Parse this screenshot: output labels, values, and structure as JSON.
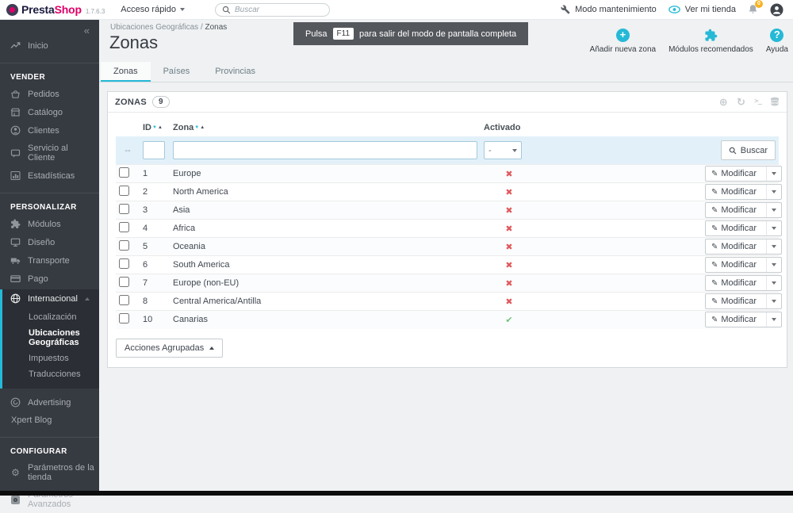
{
  "topbar": {
    "brand_presta": "Presta",
    "brand_shop": "Shop",
    "version": "1.7.6.3",
    "quick_access": "Acceso rápido",
    "search_placeholder": "Buscar",
    "maintenance_label": "Modo mantenimiento",
    "view_shop_label": "Ver mi tienda",
    "notification_badge": "0"
  },
  "sidebar": {
    "collapse": "«",
    "home": "Inicio",
    "vender_title": "VENDER",
    "pedidos": "Pedidos",
    "catalogo": "Catálogo",
    "clientes": "Clientes",
    "servicio": "Servicio al Cliente",
    "estadisticas": "Estadísticas",
    "personalizar_title": "PERSONALIZAR",
    "modulos": "Módulos",
    "diseno": "Diseño",
    "transporte": "Transporte",
    "pago": "Pago",
    "internacional": "Internacional",
    "localizacion": "Localización",
    "ubicaciones": "Ubicaciones Geográficas",
    "impuestos": "Impuestos",
    "traducciones": "Traducciones",
    "advertising": "Advertising",
    "xpert_blog": "Xpert Blog",
    "configurar_title": "CONFIGURAR",
    "parametros_tienda": "Parámetros de la tienda",
    "parametros_avanzados": "Parámetros Avanzados"
  },
  "header": {
    "breadcrumb_parent": "Ubicaciones Geográficas",
    "breadcrumb_sep": "/",
    "breadcrumb_current": "Zonas",
    "title": "Zonas",
    "toast": {
      "prefix": "Pulsa",
      "key": "F11",
      "suffix": "para salir del modo de pantalla completa"
    },
    "actions": {
      "add": "Añadir nueva zona",
      "modules": "Módulos recomendados",
      "help": "Ayuda"
    }
  },
  "tabs": {
    "zonas": "Zonas",
    "paises": "Países",
    "provincias": "Provincias"
  },
  "panel": {
    "title": "ZONAS",
    "count": "9"
  },
  "table": {
    "col_id": "ID",
    "col_zona": "Zona",
    "col_activado": "Activado",
    "filter_dash": "--",
    "filter_select_value": "-",
    "search_button": "Buscar",
    "row_action": "Modificar",
    "rows": [
      {
        "id": "1",
        "zone": "Europe",
        "active": false
      },
      {
        "id": "2",
        "zone": "North America",
        "active": false
      },
      {
        "id": "3",
        "zone": "Asia",
        "active": false
      },
      {
        "id": "4",
        "zone": "Africa",
        "active": false
      },
      {
        "id": "5",
        "zone": "Oceania",
        "active": false
      },
      {
        "id": "6",
        "zone": "South America",
        "active": false
      },
      {
        "id": "7",
        "zone": "Europe (non-EU)",
        "active": false
      },
      {
        "id": "8",
        "zone": "Central America/Antilla",
        "active": false
      },
      {
        "id": "10",
        "zone": "Canarias",
        "active": true
      }
    ]
  },
  "bulk": {
    "label": "Acciones Agrupadas"
  },
  "glyphs": {
    "check": "✔",
    "cross": "✖",
    "pencil": "✎",
    "sort_down": "▼",
    "sort_up": "▲",
    "add_circle": "⊕",
    "refresh": "↻",
    "terminal": ">_",
    "gear": "⚙"
  },
  "colors": {
    "accent": "#25b9d7",
    "brand_pink": "#df0067",
    "sidebar_bg": "#363a41",
    "status_on": "#72c279",
    "status_off": "#e0595c",
    "badge_orange": "#f8b320"
  }
}
